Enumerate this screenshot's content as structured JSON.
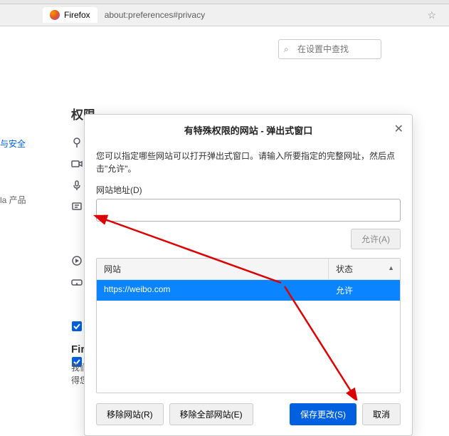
{
  "browser": {
    "tab_label": "Firefox",
    "url": "about:preferences#privacy"
  },
  "search": {
    "placeholder": "在设置中查找"
  },
  "sidebar": {
    "security": "与安全",
    "product": "la 产品"
  },
  "bg": {
    "heading": "权限",
    "heading2": "Fir",
    "text1": "我们",
    "text2": "得您"
  },
  "modal": {
    "title": "有特殊权限的网站 - 弹出式窗口",
    "description": "您可以指定哪些网站可以打开弹出式窗口。请输入所要指定的完整网址，然后点击\"允许\"。",
    "url_label": "网站地址(D)",
    "allow_btn": "允许(A)",
    "table": {
      "col_site": "网站",
      "col_status": "状态",
      "rows": [
        {
          "site": "https://weibo.com",
          "status": "允许"
        }
      ]
    },
    "remove_btn": "移除网站(R)",
    "remove_all_btn": "移除全部网站(E)",
    "save_btn": "保存更改(S)",
    "cancel_btn": "取消"
  }
}
